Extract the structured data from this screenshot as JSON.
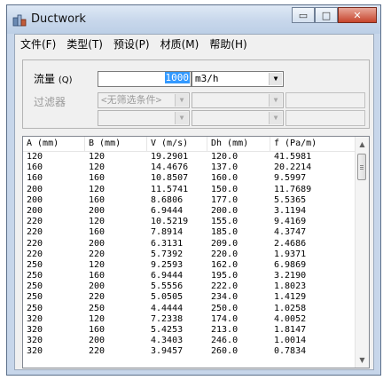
{
  "window": {
    "title": "Ductwork"
  },
  "caption_buttons": {
    "minimize": "▭",
    "maximize": "□",
    "close": "✕"
  },
  "menu": [
    {
      "label": "文件(F)"
    },
    {
      "label": "类型(T)"
    },
    {
      "label": "预设(P)"
    },
    {
      "label": "材质(M)"
    },
    {
      "label": "帮助(H)"
    }
  ],
  "form": {
    "flow_label": "流量",
    "flow_label_suffix": "(Q)",
    "flow_value": "1000",
    "flow_unit": "m3/h",
    "filter_label": "过滤器",
    "filter_placeholder": "<无筛选条件>"
  },
  "table": {
    "columns": [
      "A (mm)",
      "B (mm)",
      "V (m/s)",
      "Dh (mm)",
      "f (Pa/m)"
    ],
    "rows": [
      [
        "120",
        "120",
        "19.2901",
        "120.0",
        "41.5981"
      ],
      [
        "160",
        "120",
        "14.4676",
        "137.0",
        "20.2214"
      ],
      [
        "160",
        "160",
        "10.8507",
        "160.0",
        "9.5997"
      ],
      [
        "200",
        "120",
        "11.5741",
        "150.0",
        "11.7689"
      ],
      [
        "200",
        "160",
        "8.6806",
        "177.0",
        "5.5365"
      ],
      [
        "200",
        "200",
        "6.9444",
        "200.0",
        "3.1194"
      ],
      [
        "220",
        "120",
        "10.5219",
        "155.0",
        "9.4169"
      ],
      [
        "220",
        "160",
        "7.8914",
        "185.0",
        "4.3747"
      ],
      [
        "220",
        "200",
        "6.3131",
        "209.0",
        "2.4686"
      ],
      [
        "220",
        "220",
        "5.7392",
        "220.0",
        "1.9371"
      ],
      [
        "250",
        "120",
        "9.2593",
        "162.0",
        "6.9869"
      ],
      [
        "250",
        "160",
        "6.9444",
        "195.0",
        "3.2190"
      ],
      [
        "250",
        "200",
        "5.5556",
        "222.0",
        "1.8023"
      ],
      [
        "250",
        "220",
        "5.0505",
        "234.0",
        "1.4129"
      ],
      [
        "250",
        "250",
        "4.4444",
        "250.0",
        "1.0258"
      ],
      [
        "320",
        "120",
        "7.2338",
        "174.0",
        "4.0052"
      ],
      [
        "320",
        "160",
        "5.4253",
        "213.0",
        "1.8147"
      ],
      [
        "320",
        "200",
        "4.3403",
        "246.0",
        "1.0014"
      ],
      [
        "320",
        "220",
        "3.9457",
        "260.0",
        "0.7834"
      ]
    ]
  }
}
